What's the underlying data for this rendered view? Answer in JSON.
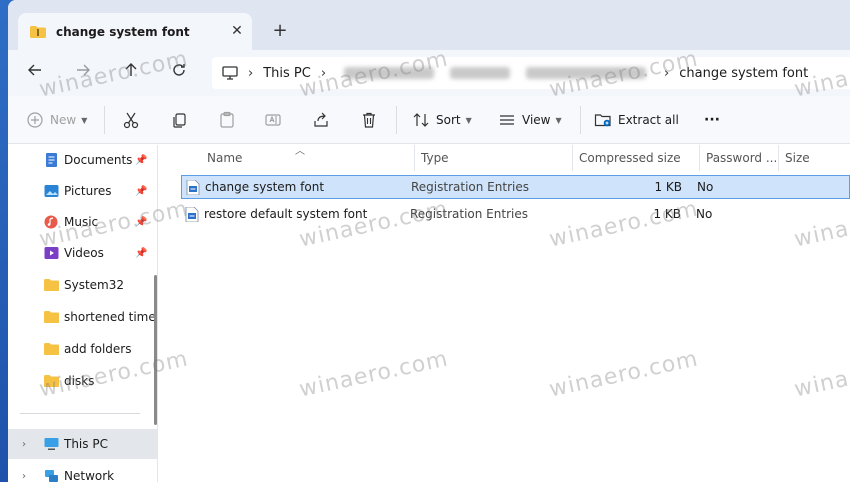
{
  "tab": {
    "title": "change system font",
    "close": "✕",
    "new": "+"
  },
  "address": {
    "this_pc": "This PC",
    "current": "change system font"
  },
  "commands": {
    "new": "New",
    "sort": "Sort",
    "view": "View",
    "extract_all": "Extract all",
    "more": "···"
  },
  "sidebar": {
    "items": [
      {
        "label": "Documents",
        "pinned": true
      },
      {
        "label": "Pictures",
        "pinned": true
      },
      {
        "label": "Music",
        "pinned": true
      },
      {
        "label": "Videos",
        "pinned": true
      },
      {
        "label": "System32"
      },
      {
        "label": "shortened time"
      },
      {
        "label": "add folders"
      },
      {
        "label": "disks"
      },
      {
        "label": "This PC"
      },
      {
        "label": "Network"
      }
    ]
  },
  "columns": {
    "name": "Name",
    "type": "Type",
    "compressed_size": "Compressed size",
    "password": "Password ...",
    "size": "Size"
  },
  "files": [
    {
      "name": "change system font",
      "type": "Registration Entries",
      "compressed": "1 KB",
      "password": "No"
    },
    {
      "name": "restore default system font",
      "type": "Registration Entries",
      "compressed": "1 KB",
      "password": "No"
    }
  ],
  "watermark": "winaero.com",
  "colors": {
    "accent": "#0067c0",
    "selected_row": "#cfe4fa",
    "folder": "#f6c244"
  }
}
